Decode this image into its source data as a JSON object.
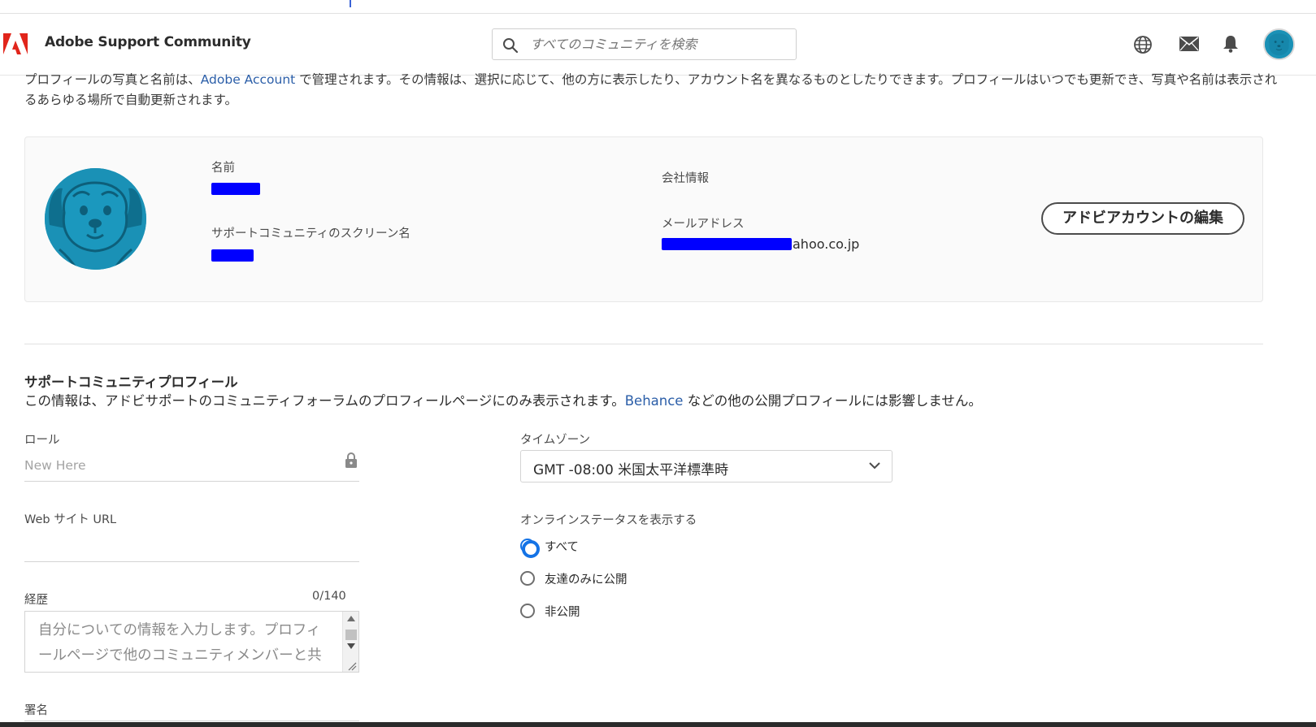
{
  "header": {
    "brand": "Adobe Support Community",
    "search_placeholder": "すべてのコミュニティを検索"
  },
  "intro": {
    "part1": "プロフィールの写真と名前は、",
    "link": "Adobe Account",
    "part2": " で管理されます。その情報は、選択に応じて、他の方に表示したり、アカウント名を異なるものとしたりできます。プロフィールはいつでも更新でき、写真や名前は表示されるあらゆる場所で自動更新されます。"
  },
  "account_card": {
    "name_label": "名前",
    "screen_name_label": "サポートコミュニティのスクリーン名",
    "company_label": "会社情報",
    "email_label": "メールアドレス",
    "email_visible_part": "ahoo.co.jp",
    "edit_button": "アドビアカウントの編集"
  },
  "community_profile": {
    "title": "サポートコミュニティプロフィール",
    "desc_part1": "この情報は、アドビサポートのコミュニティフォーラムのプロフィールページにのみ表示されます。",
    "desc_link": "Behance",
    "desc_part2": " などの他の公開プロフィールには影響しません。",
    "role_label": "ロール",
    "role_value": "New Here",
    "website_label": "Web サイト URL",
    "bio_label": "経歴",
    "bio_counter": "0/140",
    "bio_placeholder": "自分についての情報を入力します。プロフィールページで他のコミュニティメンバーと共有されます。",
    "signature_label": "署名",
    "timezone_label": "タイムゾーン",
    "timezone_value": "GMT -08:00 米国太平洋標準時",
    "online_status_label": "オンラインステータスを表示する",
    "online_status_options": [
      "すべて",
      "友達のみに公開",
      "非公開"
    ],
    "online_status_selected": "すべて"
  },
  "colors": {
    "accent": "#1473e6",
    "link": "#2b5ea8",
    "avatar_bg": "#1a91b6",
    "redaction": "#0000ff"
  }
}
